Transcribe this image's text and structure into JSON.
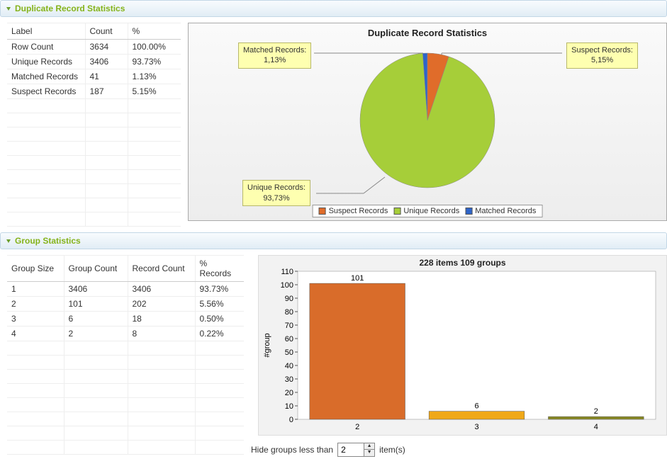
{
  "dup_panel": {
    "title": "Duplicate Record Statistics",
    "columns": [
      "Label",
      "Count",
      "%"
    ],
    "rows": [
      {
        "label": "Row Count",
        "count": "3634",
        "pct": "100.00%"
      },
      {
        "label": "Unique Records",
        "count": "3406",
        "pct": "93.73%"
      },
      {
        "label": "Matched Records",
        "count": "41",
        "pct": "1.13%"
      },
      {
        "label": "Suspect Records",
        "count": "187",
        "pct": "5.15%"
      }
    ],
    "chart_title": "Duplicate Record Statistics",
    "callouts": {
      "matched": {
        "name": "Matched Records:",
        "pct": "1,13%"
      },
      "suspect": {
        "name": "Suspect Records:",
        "pct": "5,15%"
      },
      "unique": {
        "name": "Unique Records:",
        "pct": "93,73%"
      }
    },
    "legend": {
      "suspect": "Suspect Records",
      "unique": "Unique Records",
      "matched": "Matched Records"
    }
  },
  "grp_panel": {
    "title": "Group Statistics",
    "columns": [
      "Group Size",
      "Group Count",
      "Record Count",
      "% Records"
    ],
    "rows": [
      {
        "size": "1",
        "gcount": "3406",
        "rcount": "3406",
        "pct": "93.73%"
      },
      {
        "size": "2",
        "gcount": "101",
        "rcount": "202",
        "pct": "5.56%"
      },
      {
        "size": "3",
        "gcount": "6",
        "rcount": "18",
        "pct": "0.50%"
      },
      {
        "size": "4",
        "gcount": "2",
        "rcount": "8",
        "pct": "0.22%"
      }
    ],
    "chart_title": "228 items 109 groups",
    "ylabel": "#group",
    "control": {
      "prefix": "Hide groups less than",
      "value": "2",
      "suffix": "item(s)"
    }
  },
  "chart_data": [
    {
      "type": "pie",
      "title": "Duplicate Record Statistics",
      "series": [
        {
          "name": "Suspect Records",
          "value": 5.15,
          "color": "#e06c2a"
        },
        {
          "name": "Unique Records",
          "value": 93.73,
          "color": "#a6ce39"
        },
        {
          "name": "Matched Records",
          "value": 1.13,
          "color": "#2e64c9"
        }
      ]
    },
    {
      "type": "bar",
      "title": "228 items 109 groups",
      "categories": [
        "2",
        "3",
        "4"
      ],
      "values": [
        101,
        6,
        2
      ],
      "colors": [
        "#d96c2a",
        "#f0a818",
        "#8a8a23"
      ],
      "ylabel": "#group",
      "ylim": [
        0,
        110
      ],
      "ytick_step": 10
    }
  ]
}
